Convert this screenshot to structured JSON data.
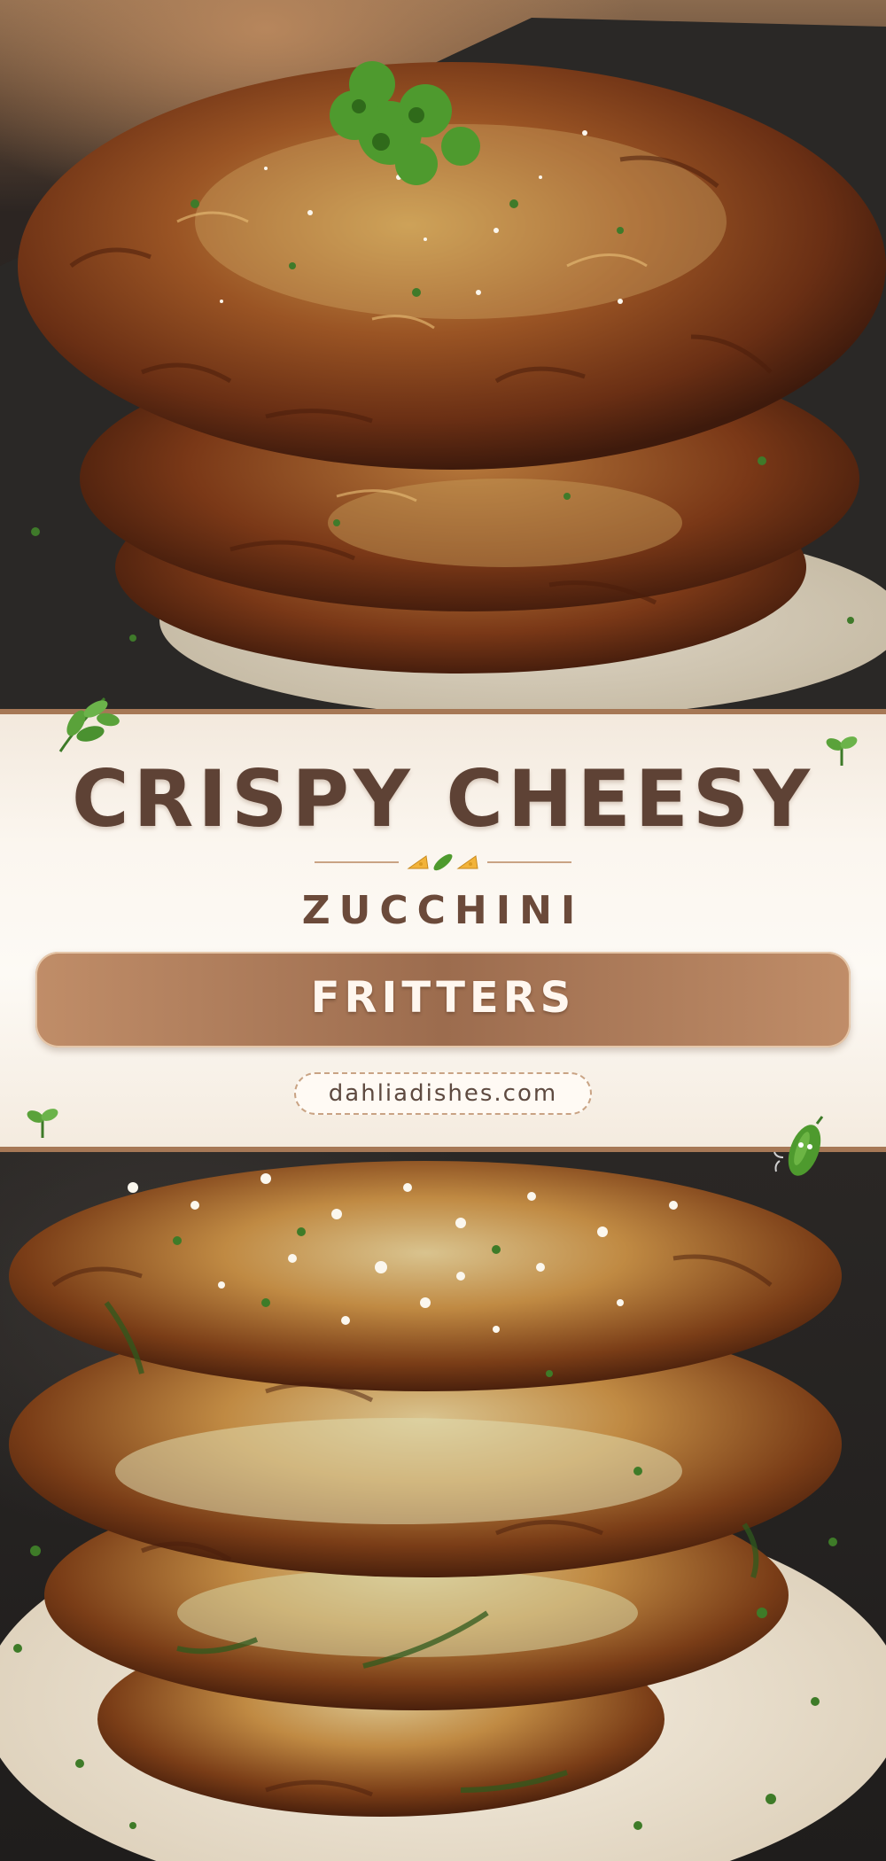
{
  "title": {
    "line1": "CRISPY CHEESY",
    "line2": "ZUCCHINI",
    "line3": "FRITTERS"
  },
  "website": "dahliadishes.com",
  "photos": {
    "top": "zucchini-fritters-stack-photo",
    "bottom": "zucchini-fritters-stack-with-sauce-photo"
  },
  "icons": [
    "leaf-sprig-icon",
    "seedling-icon",
    "cheese-icon",
    "zucchini-icon",
    "zucchini-character-icon"
  ],
  "colors": {
    "title": "#5e4235",
    "band_background": "#fbf6ef",
    "border": "#a67856",
    "pill": "#a87858",
    "pill_text": "#fff7ef"
  }
}
